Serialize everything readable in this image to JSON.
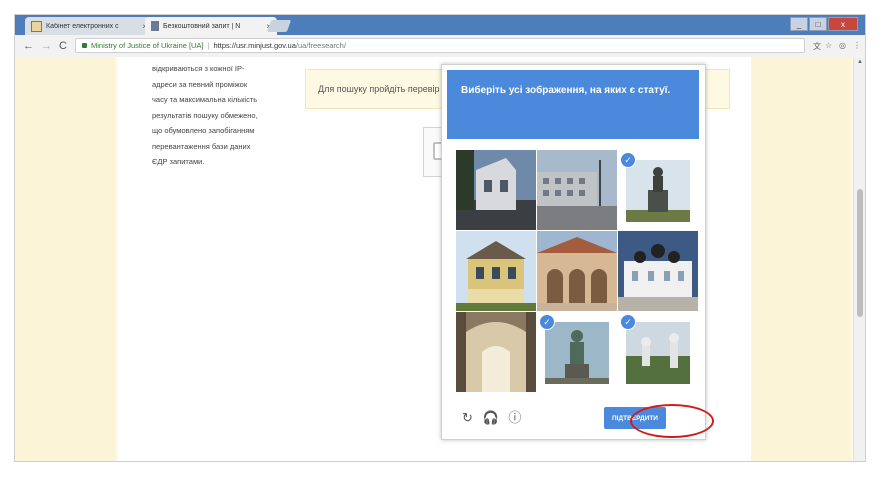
{
  "browser": {
    "tabs": [
      {
        "label": "Кабінет електронних с"
      },
      {
        "label": "Безкоштовний запит | N"
      }
    ],
    "tab_close_glyph": "×",
    "omnibox": {
      "security_label": "Ministry of Justice of Ukraine [UA]",
      "separator": "|",
      "url_host": "https://usr.minjust.gov.ua",
      "url_path": "/ua/freesearch/"
    },
    "nav": {
      "back": "←",
      "forward": "→",
      "reload": "C"
    },
    "window": {
      "minimize": "_",
      "maximize": "□",
      "close": "x"
    },
    "toolbar_icons": [
      "translate-icon",
      "star-icon",
      "extension-icon",
      "menu-icon"
    ],
    "toolbar_glyphs": {
      "translate": "文",
      "star": "☆",
      "extension": "◎",
      "menu": "⋮"
    }
  },
  "page": {
    "left_info_lines": [
      "відкриваються з кожної IP-",
      "адреси за певний проміжок",
      "часу та максимальна кількість",
      "результатів пошуку обмежено,",
      "що обумовлено запобіганням",
      "перевантаження бази даних",
      "ЄДР запитами."
    ],
    "notice": "Для пошуку пройдіть перевір"
  },
  "challenge": {
    "header": "Виберіть усі зображення, на яких є статуї.",
    "verify_label": "ПІДТВЕРДИТИ",
    "tools": {
      "reload": "↻",
      "audio": "🎧",
      "info": "ⓘ"
    },
    "check_glyph": "✓",
    "tiles": [
      {
        "name": "tile-house-street",
        "selected": false
      },
      {
        "name": "tile-building-road",
        "selected": false
      },
      {
        "name": "tile-statue-monument",
        "selected": true
      },
      {
        "name": "tile-yellow-house",
        "selected": false
      },
      {
        "name": "tile-church-facade",
        "selected": false
      },
      {
        "name": "tile-monastery",
        "selected": false
      },
      {
        "name": "tile-church-interior",
        "selected": false
      },
      {
        "name": "tile-statue-figure",
        "selected": true
      },
      {
        "name": "tile-statue-park",
        "selected": true
      }
    ]
  },
  "colors": {
    "accent": "#4a89dc",
    "highlight_ellipse": "#d11a1a",
    "page_bg": "#fdf9e3"
  }
}
